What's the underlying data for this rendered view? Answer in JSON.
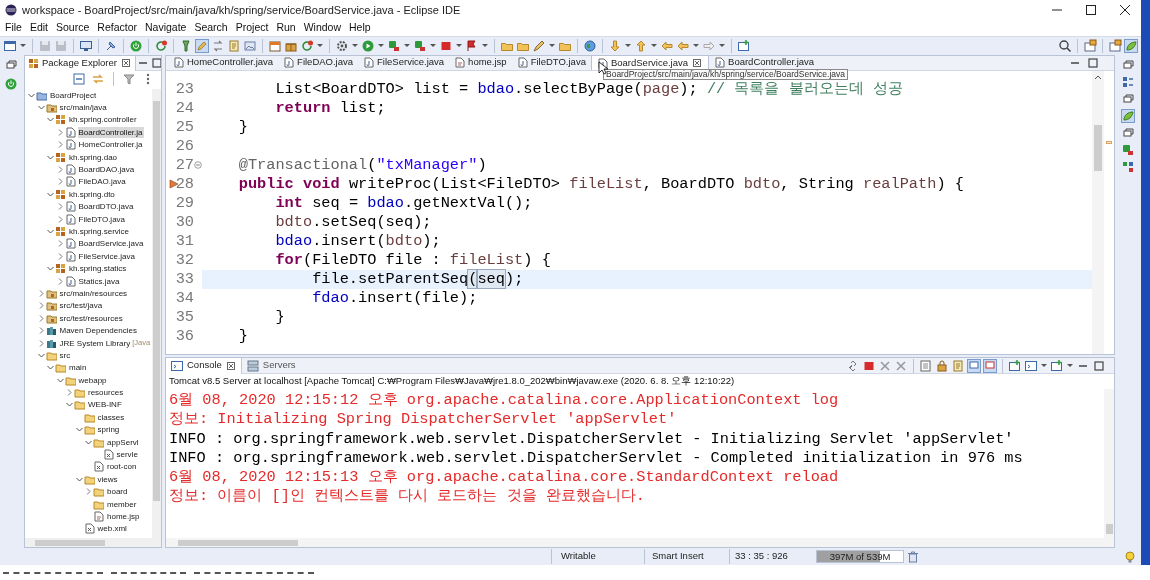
{
  "window": {
    "title": "workspace - BoardProject/src/main/java/kh/spring/service/BoardService.java - Eclipse IDE"
  },
  "menu": [
    "File",
    "Edit",
    "Source",
    "Refactor",
    "Navigate",
    "Search",
    "Project",
    "Run",
    "Window",
    "Help"
  ],
  "package_explorer": {
    "title": "Package Explorer",
    "tree": [
      {
        "label": "BoardProject",
        "kind": "project",
        "expanded": true,
        "selected": false,
        "children": [
          {
            "label": "src/main/java",
            "kind": "source-folder",
            "expanded": true,
            "selected": false,
            "children": [
              {
                "label": "kh.spring.controller",
                "kind": "package",
                "expanded": true,
                "selected": false,
                "children": [
                  {
                    "label": "BoardController.ja",
                    "kind": "java-file",
                    "expanded": false,
                    "selected": true
                  },
                  {
                    "label": "HomeController.ja",
                    "kind": "java-file",
                    "expanded": false,
                    "selected": false
                  }
                ]
              },
              {
                "label": "kh.spring.dao",
                "kind": "package",
                "expanded": true,
                "selected": false,
                "children": [
                  {
                    "label": "BoardDAO.java",
                    "kind": "java-file",
                    "expanded": false,
                    "selected": false
                  },
                  {
                    "label": "FileDAO.java",
                    "kind": "java-file",
                    "expanded": false,
                    "selected": false
                  }
                ]
              },
              {
                "label": "kh.spring.dto",
                "kind": "package",
                "expanded": true,
                "selected": false,
                "children": [
                  {
                    "label": "BoardDTO.java",
                    "kind": "java-file",
                    "expanded": false,
                    "selected": false
                  },
                  {
                    "label": "FileDTO.java",
                    "kind": "java-file",
                    "expanded": false,
                    "selected": false
                  }
                ]
              },
              {
                "label": "kh.spring.service",
                "kind": "package",
                "expanded": true,
                "selected": false,
                "children": [
                  {
                    "label": "BoardService.java",
                    "kind": "java-file",
                    "expanded": false,
                    "selected": false
                  },
                  {
                    "label": "FileService.java",
                    "kind": "java-file",
                    "expanded": false,
                    "selected": false
                  }
                ]
              },
              {
                "label": "kh.spring.statics",
                "kind": "package",
                "expanded": true,
                "selected": false,
                "children": [
                  {
                    "label": "Statics.java",
                    "kind": "java-file",
                    "expanded": false,
                    "selected": false
                  }
                ]
              }
            ]
          },
          {
            "label": "src/main/resources",
            "kind": "source-folder",
            "expanded": false,
            "selected": false
          },
          {
            "label": "src/test/java",
            "kind": "source-folder",
            "expanded": false,
            "selected": false
          },
          {
            "label": "src/test/resources",
            "kind": "source-folder",
            "expanded": false,
            "selected": false
          },
          {
            "label": "Maven Dependencies",
            "kind": "library",
            "expanded": false,
            "selected": false
          },
          {
            "label": "JRE System Library",
            "decoration": "[Java",
            "kind": "library",
            "expanded": false,
            "selected": false
          },
          {
            "label": "src",
            "kind": "folder",
            "expanded": true,
            "selected": false,
            "children": [
              {
                "label": "main",
                "kind": "folder",
                "expanded": true,
                "selected": false,
                "children": [
                  {
                    "label": "webapp",
                    "kind": "folder",
                    "expanded": true,
                    "selected": false,
                    "children": [
                      {
                        "label": "resources",
                        "kind": "folder",
                        "expanded": false,
                        "selected": false
                      },
                      {
                        "label": "WEB-INF",
                        "kind": "folder",
                        "expanded": true,
                        "selected": false,
                        "children": [
                          {
                            "label": "classes",
                            "kind": "folder",
                            "selected": false
                          },
                          {
                            "label": "spring",
                            "kind": "folder",
                            "expanded": true,
                            "selected": false,
                            "children": [
                              {
                                "label": "appServl",
                                "kind": "folder",
                                "expanded": true,
                                "selected": false,
                                "children": [
                                  {
                                    "label": "servle",
                                    "kind": "xml-file",
                                    "selected": false
                                  }
                                ]
                              },
                              {
                                "label": "root-con",
                                "kind": "xml-file",
                                "selected": false
                              }
                            ]
                          },
                          {
                            "label": "views",
                            "kind": "folder",
                            "expanded": true,
                            "selected": false,
                            "children": [
                              {
                                "label": "board",
                                "kind": "folder",
                                "expanded": false,
                                "selected": false
                              },
                              {
                                "label": "member",
                                "kind": "folder",
                                "selected": false
                              },
                              {
                                "label": "home.jsp",
                                "kind": "jsp-file",
                                "selected": false
                              }
                            ]
                          },
                          {
                            "label": "web.xml",
                            "kind": "xml-file",
                            "selected": false
                          }
                        ]
                      }
                    ]
                  }
                ]
              }
            ]
          }
        ]
      }
    ]
  },
  "editor": {
    "tabs": [
      {
        "label": "HomeController.java",
        "kind": "java",
        "selected": false
      },
      {
        "label": "FileDAO.java",
        "kind": "java",
        "selected": false
      },
      {
        "label": "FileService.java",
        "kind": "java",
        "selected": false
      },
      {
        "label": "home.jsp",
        "kind": "jsp",
        "selected": false
      },
      {
        "label": "FileDTO.java",
        "kind": "java",
        "selected": false
      },
      {
        "label": "BoardService.java",
        "kind": "java",
        "selected": true
      },
      {
        "label": "BoardController.java",
        "kind": "java",
        "selected": false
      }
    ],
    "tooltip": "BoardProject/src/main/java/kh/spring/service/BoardService.java",
    "lines": [
      {
        "number": "23",
        "current": false,
        "tokens": [
          {
            "kind": "text",
            "text": "        List<BoardDTO> list = "
          },
          {
            "kind": "field",
            "text": "bdao"
          },
          {
            "kind": "text",
            "text": ".selectByPage("
          },
          {
            "kind": "param",
            "text": "page"
          },
          {
            "kind": "text",
            "text": "); "
          },
          {
            "kind": "comment",
            "text": "// 목록을 불러오는데 성공"
          }
        ]
      },
      {
        "number": "24",
        "current": false,
        "tokens": [
          {
            "kind": "keyword",
            "text": "        return"
          },
          {
            "kind": "text",
            "text": " list;"
          }
        ]
      },
      {
        "number": "25",
        "current": false,
        "tokens": [
          {
            "kind": "text",
            "text": "    }"
          }
        ]
      },
      {
        "number": "26",
        "current": false
      },
      {
        "number": "27",
        "current": false,
        "fold": true,
        "tokens": [
          {
            "kind": "annotation",
            "text": "    @Transactional"
          },
          {
            "kind": "text",
            "text": "("
          },
          {
            "kind": "string",
            "text": "\"txManager\""
          },
          {
            "kind": "text",
            "text": ")"
          }
        ]
      },
      {
        "number": "28",
        "current": false,
        "marker": true,
        "tokens": [
          {
            "kind": "keyword",
            "text": "    public"
          },
          {
            "kind": "keyword",
            "text": " void"
          },
          {
            "kind": "text",
            "text": " writeProc(List<FileDTO> "
          },
          {
            "kind": "param",
            "text": "fileList"
          },
          {
            "kind": "text",
            "text": ", BoardDTO "
          },
          {
            "kind": "param",
            "text": "bdto"
          },
          {
            "kind": "text",
            "text": ", String "
          },
          {
            "kind": "param",
            "text": "realPath"
          },
          {
            "kind": "text",
            "text": ") {"
          }
        ]
      },
      {
        "number": "29",
        "current": false,
        "tokens": [
          {
            "kind": "keyword",
            "text": "        int"
          },
          {
            "kind": "text",
            "text": " seq = "
          },
          {
            "kind": "field",
            "text": "bdao"
          },
          {
            "kind": "text",
            "text": ".getNextVal();"
          }
        ]
      },
      {
        "number": "30",
        "current": false,
        "tokens": [
          {
            "kind": "param",
            "text": "        bdto"
          },
          {
            "kind": "text",
            "text": ".setSeq(seq);"
          }
        ]
      },
      {
        "number": "31",
        "current": false,
        "tokens": [
          {
            "kind": "field",
            "text": "        bdao"
          },
          {
            "kind": "text",
            "text": ".insert("
          },
          {
            "kind": "param",
            "text": "bdto"
          },
          {
            "kind": "text",
            "text": ");"
          }
        ]
      },
      {
        "number": "32",
        "current": false,
        "tokens": [
          {
            "kind": "keyword",
            "text": "        for"
          },
          {
            "kind": "text",
            "text": "(FileDTO file : "
          },
          {
            "kind": "param",
            "text": "fileList"
          },
          {
            "kind": "text",
            "text": ") {"
          }
        ]
      },
      {
        "number": "33",
        "current": true,
        "tokens": [
          {
            "kind": "text",
            "text": "            file.setParentSeq"
          },
          {
            "kind": "text",
            "text": "(",
            "boxed": true
          },
          {
            "kind": "text",
            "text": "seq",
            "boxed": true
          },
          {
            "kind": "text",
            "text": ");"
          }
        ]
      },
      {
        "number": "34",
        "current": false,
        "tokens": [
          {
            "kind": "field",
            "text": "            fdao"
          },
          {
            "kind": "text",
            "text": ".insert(file);"
          }
        ]
      },
      {
        "number": "35",
        "current": false,
        "tokens": [
          {
            "kind": "text",
            "text": "        }"
          }
        ]
      },
      {
        "number": "36",
        "current": false,
        "tokens": [
          {
            "kind": "text",
            "text": "    }"
          }
        ]
      }
    ]
  },
  "console": {
    "tabs": [
      {
        "label": "Console",
        "selected": true
      },
      {
        "label": "Servers",
        "selected": false
      }
    ],
    "process": "Tomcat v8.5 Server at localhost [Apache Tomcat] C:₩Program Files₩Java₩jre1.8.0_202₩bin₩javaw.exe (2020. 6. 8. 오후 12:10:22)",
    "lines": [
      {
        "color": "#e42a2a",
        "text": "6월 08, 2020 12:15:12 오후 org.apache.catalina.core.ApplicationContext log"
      },
      {
        "color": "#e42a2a",
        "text": "정보: Initializing Spring DispatcherServlet 'appServlet'"
      },
      {
        "color": "#000000",
        "text": "INFO : org.springframework.web.servlet.DispatcherServlet - Initializing Servlet 'appServlet'"
      },
      {
        "color": "#000000",
        "text": "INFO : org.springframework.web.servlet.DispatcherServlet - Completed initialization in 976 ms"
      },
      {
        "color": "#e42a2a",
        "text": "6월 08, 2020 12:15:13 오후 org.apache.catalina.core.StandardContext reload"
      },
      {
        "color": "#e42a2a",
        "text": "정보: 이름이 []인 컨텍스트를 다시 로드하는 것을 완료했습니다."
      }
    ]
  },
  "status_bar": {
    "mode": "Writable",
    "insert_mode": "Smart Insert",
    "position": "33 : 35 : 926",
    "memory": {
      "text": "397M of 539M",
      "level": 0.737
    }
  }
}
